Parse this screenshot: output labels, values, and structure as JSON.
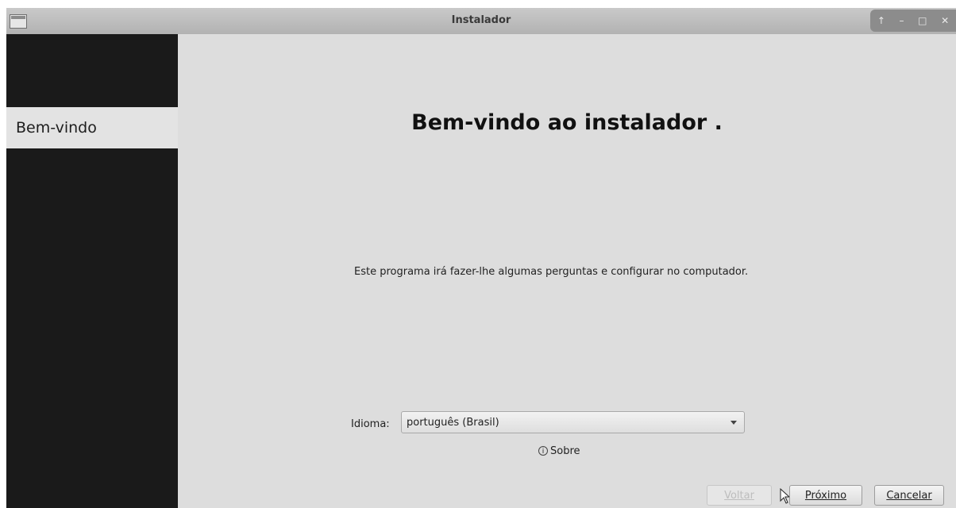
{
  "window": {
    "title": "Instalador",
    "controls": [
      "↑",
      "–",
      "□",
      "✕"
    ]
  },
  "sidebar": {
    "items": [
      {
        "label": "Bem-vindo",
        "active": true
      }
    ]
  },
  "main": {
    "heading": "Bem-vindo ao instalador .",
    "description": "Este programa irá fazer-lhe algumas perguntas e configurar  no computador.",
    "language": {
      "label": "Idioma:",
      "value": "português (Brasil)"
    },
    "about_label": "Sobre",
    "about_icon": "info-icon"
  },
  "buttons": {
    "back": "Voltar",
    "next": "Próximo",
    "cancel": "Cancelar"
  },
  "colors": {
    "sidebar_bg": "#1a1a1a",
    "main_bg": "#dddddd",
    "titlebar_bg": "#bdbdbd"
  }
}
